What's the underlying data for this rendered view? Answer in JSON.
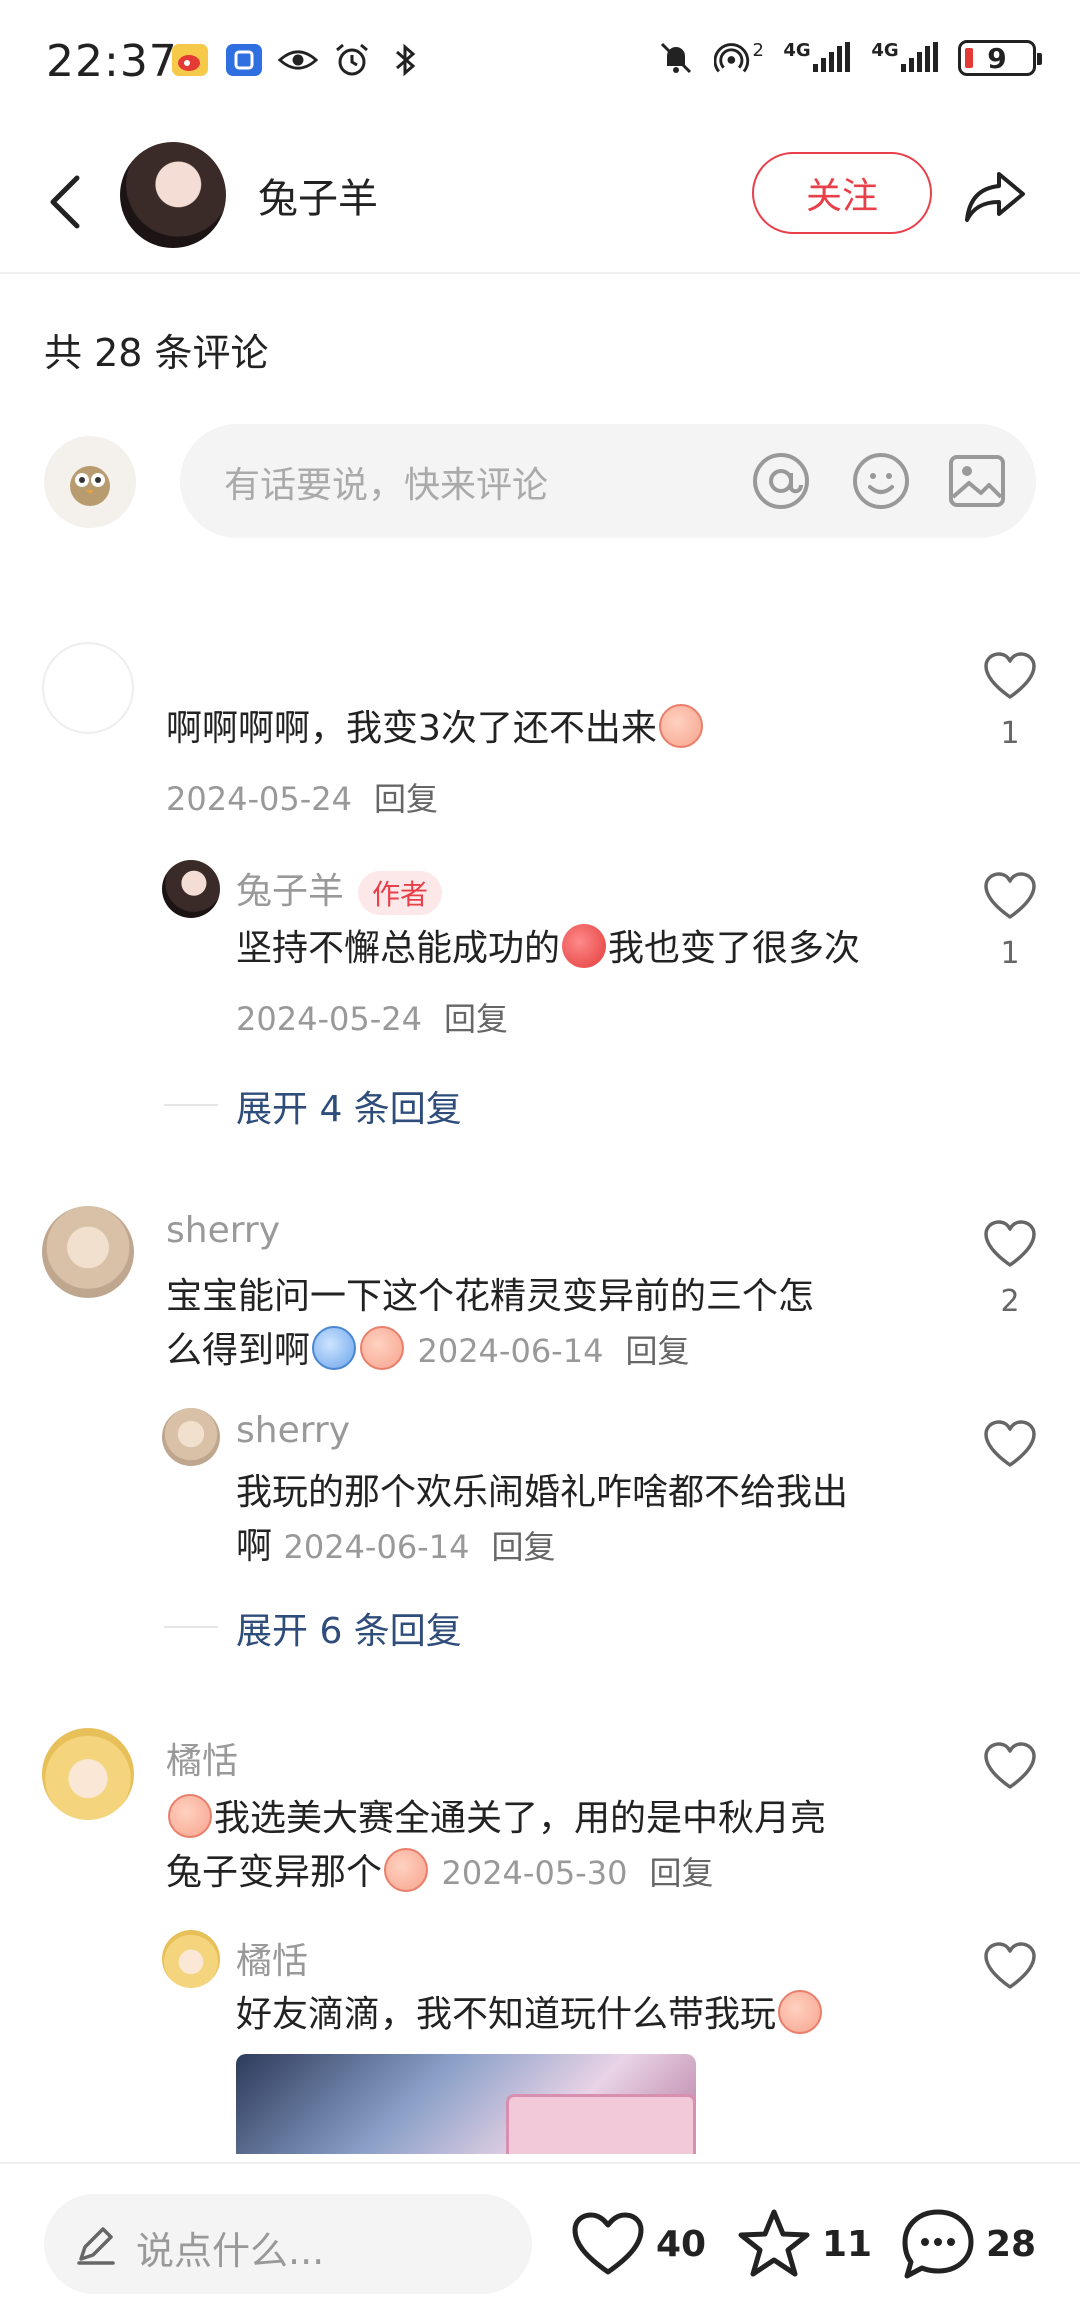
{
  "status_bar": {
    "time": "22:37",
    "left_icons": [
      "weibo-icon",
      "app-icon",
      "eye-icon",
      "alarm-icon",
      "bluetooth-icon"
    ],
    "right_icons": [
      "mute-bell-icon",
      "hotspot-icon",
      "signal-4g-icon",
      "signal-4g-icon"
    ],
    "hotspot_label": "2",
    "network_label": "4G",
    "battery": "9"
  },
  "header": {
    "author_name": "兔子羊",
    "follow_label": "关注"
  },
  "comments_header": {
    "count_text": "共 28 条评论"
  },
  "comment_input": {
    "placeholder": "有话要说，快来评论"
  },
  "comments": [
    {
      "text": "啊啊啊啊，我变3次了还不出来",
      "date": "2024-05-24",
      "reply": "回复",
      "likes": "1",
      "sub": {
        "name": "兔子羊",
        "tag": "作者",
        "text_a": "坚持不懈总能成功的",
        "text_b": "我也变了很多次",
        "date": "2024-05-24",
        "reply": "回复",
        "likes": "1"
      },
      "expand": "展开 4 条回复"
    },
    {
      "name": "sherry",
      "text_line1": "宝宝能问一下这个花精灵变异前的三个怎",
      "text_line2": "么得到啊",
      "date": "2024-06-14",
      "reply": "回复",
      "likes": "2",
      "sub": {
        "name": "sherry",
        "text_line1": "我玩的那个欢乐闹婚礼咋啥都不给我出",
        "text_line2": "啊",
        "date": "2024-06-14",
        "reply": "回复"
      },
      "expand": "展开 6 条回复"
    },
    {
      "name": "橘恬",
      "text_line1": "我选美大赛全通关了，用的是中秋月亮",
      "text_line2": "兔子变异那个",
      "date": "2024-05-30",
      "reply": "回复",
      "sub": {
        "name": "橘恬",
        "text": "好友滴滴，我不知道玩什么带我玩"
      }
    }
  ],
  "bottom_bar": {
    "placeholder": "说点什么...",
    "likes": "40",
    "favorites": "11",
    "comments": "28"
  },
  "colors": {
    "accent": "#e8404a",
    "link": "#2f4d7a",
    "muted": "#999999"
  }
}
